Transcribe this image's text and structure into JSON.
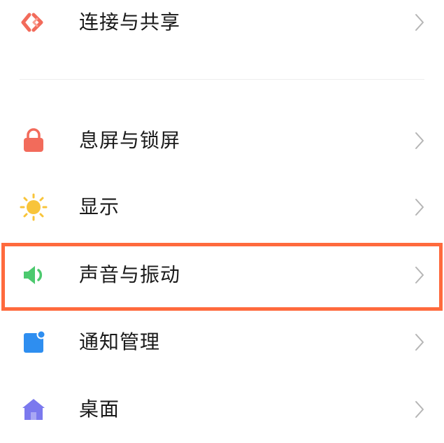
{
  "settings": {
    "items": [
      {
        "label": "连接与共享",
        "icon": "connection-share-icon",
        "color": "#f26b5b"
      },
      {
        "label": "息屏与锁屏",
        "icon": "lock-icon",
        "color": "#f26b5b"
      },
      {
        "label": "显示",
        "icon": "sun-icon",
        "color": "#f8c43a"
      },
      {
        "label": "声音与振动",
        "icon": "speaker-icon",
        "color": "#4cc96e"
      },
      {
        "label": "通知管理",
        "icon": "notification-icon",
        "color": "#2e8ef0"
      },
      {
        "label": "桌面",
        "icon": "home-icon",
        "color": "#7b79ee"
      }
    ],
    "chevron_icon": "chevron-right-icon",
    "highlight_color": "#ff6a3d"
  }
}
